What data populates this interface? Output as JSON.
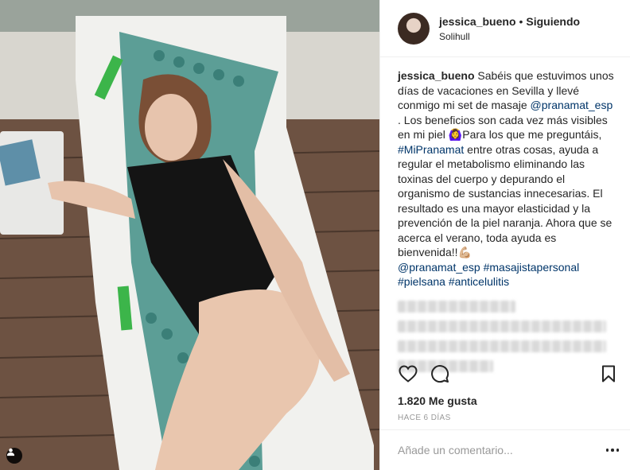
{
  "post": {
    "username": "jessica_bueno",
    "separator": "•",
    "follow_status": "Siguiendo",
    "location": "Solihull"
  },
  "caption": {
    "username": "jessica_bueno",
    "text_1": " Sabéis que estuvimos unos días de vacaciones en Sevilla y llevé conmigo mi set de masaje ",
    "mention_1": "@pranamat_esp",
    "text_2": " . Los beneficios son cada vez más visibles en mi piel 🙆‍♀️Para los que me preguntáis, ",
    "hashtag_1": "#MiPranamat",
    "text_3": " entre otras cosas, ayuda a regular el metabolismo eliminando las toxinas del cuerpo y depurando el organismo de sustancias innecesarias. El resultado es una mayor elasticidad y la prevención de la piel naranja. Ahora que se acerca el verano, toda ayuda es bienvenida!!💪🏼",
    "tag_mention": "@pranamat_esp",
    "tag_1": "#masajistapersonal",
    "tag_2": "#pielsana",
    "tag_3": "#anticelulitis"
  },
  "stats": {
    "likes": "1.820 Me gusta",
    "timestamp": "HACE 6 DÍAS"
  },
  "comment_box": {
    "placeholder": "Añade un comentario..."
  },
  "icons": {
    "like": "heart-icon",
    "comment": "comment-bubble-icon",
    "save": "bookmark-icon",
    "more": "more-options-icon",
    "user_tags": "user-tag-icon"
  }
}
